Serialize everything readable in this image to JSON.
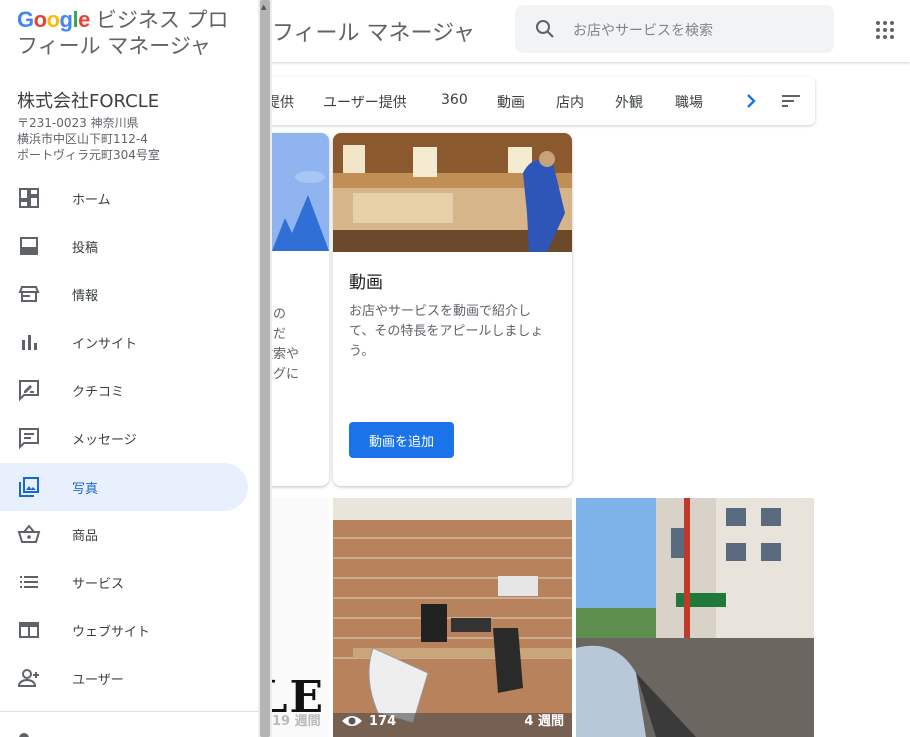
{
  "colors": {
    "accent": "#1a73e8",
    "active_bg": "#e8f0fe",
    "active_text": "#1967d2",
    "icon": "#5f6368",
    "google_blue": "#4285f4",
    "google_red": "#ea4335",
    "google_yellow": "#fbbc05",
    "google_green": "#34a853"
  },
  "header": {
    "title_fragment": "フィール マネージャ",
    "search_placeholder": "お店やサービスを検索",
    "search_icon": "search-icon",
    "apps_icon": "apps-grid-icon"
  },
  "photo_tabs": {
    "items": [
      "提供",
      "ユーザー提供",
      "360",
      "動画",
      "店内",
      "外観",
      "職場"
    ],
    "next_icon": "chevron-right-icon",
    "sort_icon": "sort-icon"
  },
  "cards": {
    "left_text": [
      "スの",
      "くだ",
      "検索や",
      "ングに"
    ],
    "video": {
      "title": "動画",
      "description": "お店やサービスを動画で紹介して、その特長をアピールしましょう。",
      "button": "動画を追加"
    }
  },
  "tiles": {
    "left_logo_letters": "LE",
    "left_caption": "19 週間",
    "middle_views": "174",
    "middle_age": "4 週間"
  },
  "drawer": {
    "brand_google": [
      "G",
      "o",
      "o",
      "g",
      "l",
      "e"
    ],
    "brand_title": "ビジネス プロフィール マネージャ",
    "business_name": "株式会社FORCLE",
    "address": [
      "〒231-0023 神奈川県",
      "横浜市中区山下町112-4",
      "ポートヴィラ元町304号室"
    ],
    "nav": [
      {
        "label": "ホーム",
        "icon": "dashboard-icon"
      },
      {
        "label": "投稿",
        "icon": "posts-icon"
      },
      {
        "label": "情報",
        "icon": "storefront-icon"
      },
      {
        "label": "インサイト",
        "icon": "bar-chart-icon"
      },
      {
        "label": "クチコミ",
        "icon": "rate-review-icon"
      },
      {
        "label": "メッセージ",
        "icon": "message-icon"
      },
      {
        "label": "写真",
        "icon": "photo-library-icon",
        "active": true
      },
      {
        "label": "商品",
        "icon": "shopping-basket-icon"
      },
      {
        "label": "サービス",
        "icon": "list-icon"
      },
      {
        "label": "ウェブサイト",
        "icon": "web-icon"
      },
      {
        "label": "ユーザー",
        "icon": "person-add-icon"
      }
    ]
  }
}
